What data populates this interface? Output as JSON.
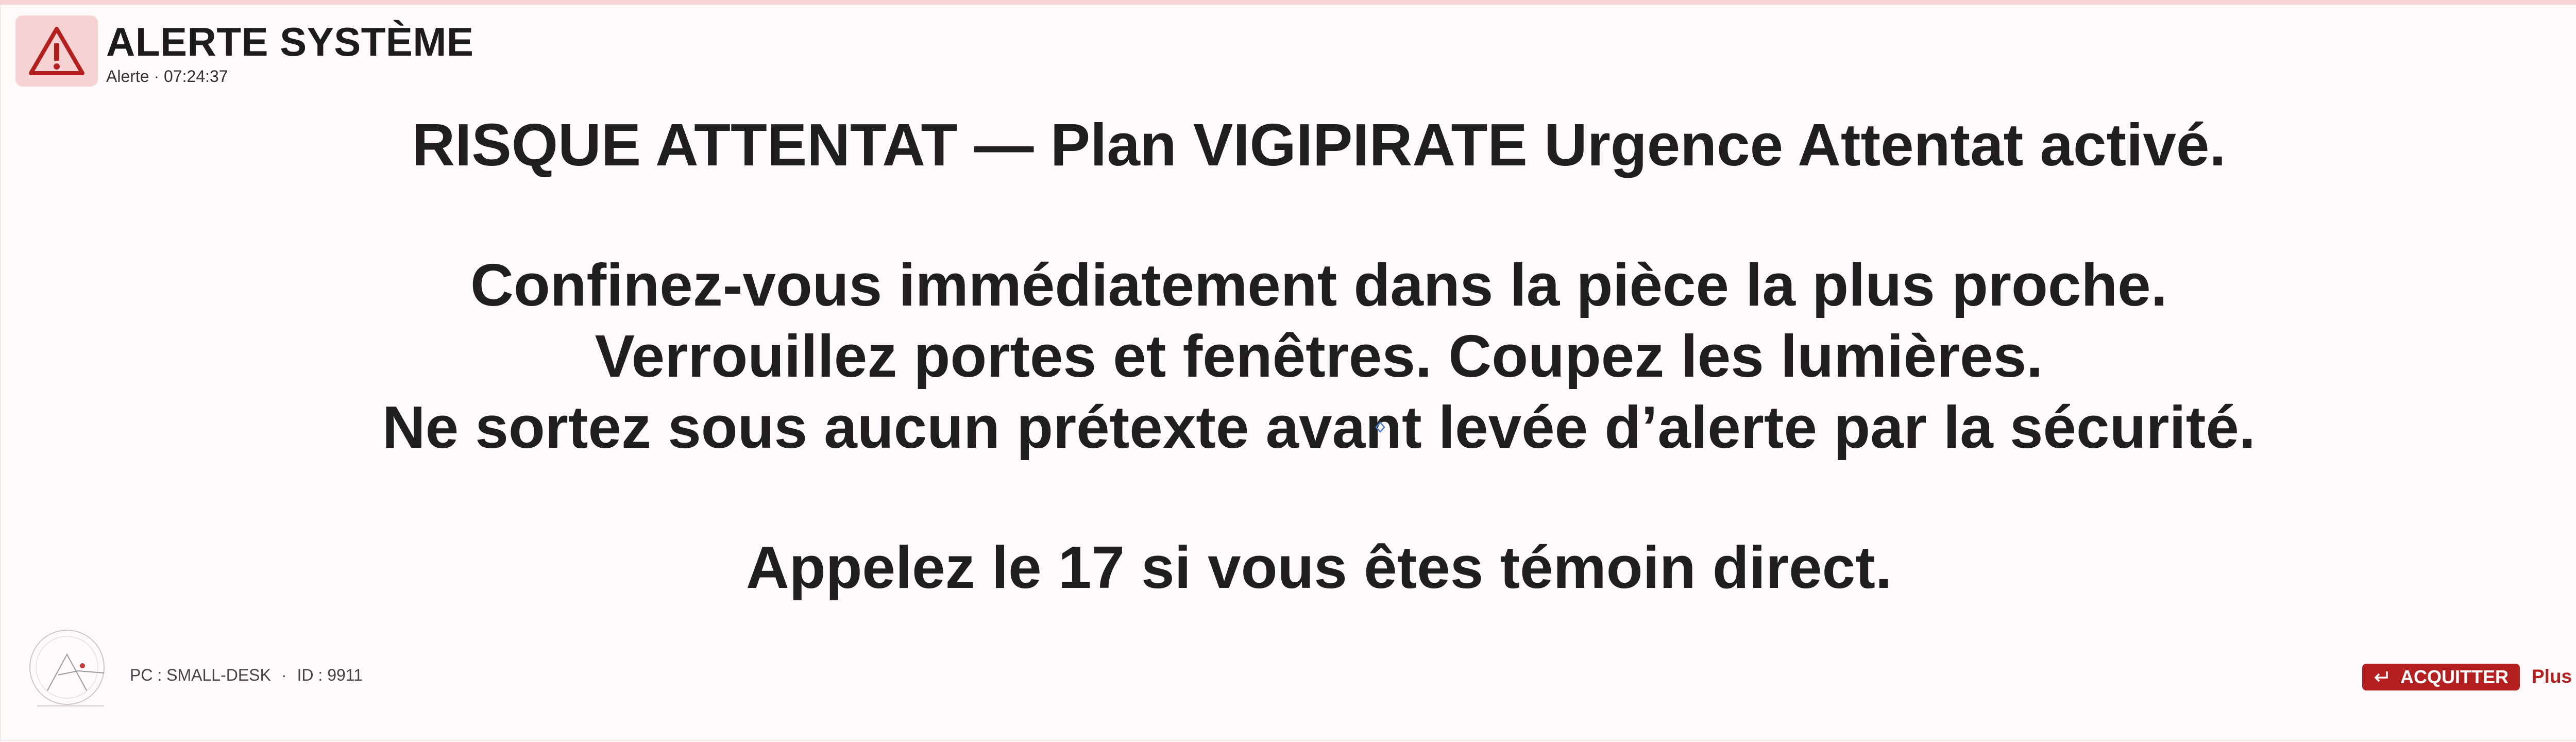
{
  "header": {
    "title": "ALERTE SYSTÈME",
    "subtitle": "Alerte · 07:24:37",
    "icon": "warning-triangle-icon",
    "close_icon": "close-icon"
  },
  "message": {
    "headline": "RISQUE ATTENTAT — Plan VIGIPIRATE Urgence Attentat activé.",
    "instructions": [
      "Confinez-vous immédiatement dans la pièce la plus proche.",
      "Verrouillez portes et fenêtres. Coupez les lumières.",
      "Ne sortez sous aucun prétexte avant levée d’alerte par la sécurité."
    ],
    "call_to_action": "Appelez le 17 si vous êtes témoin direct."
  },
  "footer": {
    "pc_label": "PC : SMALL-DESK",
    "separator": "·",
    "id_label": "ID : 9911",
    "acknowledge_label": "ACQUITTER",
    "later_label": "Plus tard",
    "logo_icon": "seal-logo-icon"
  },
  "colors": {
    "accent": "#b3201f",
    "icon_bg": "#f6d2d2",
    "background": "#fff9f9",
    "text": "#1f1f1f"
  }
}
